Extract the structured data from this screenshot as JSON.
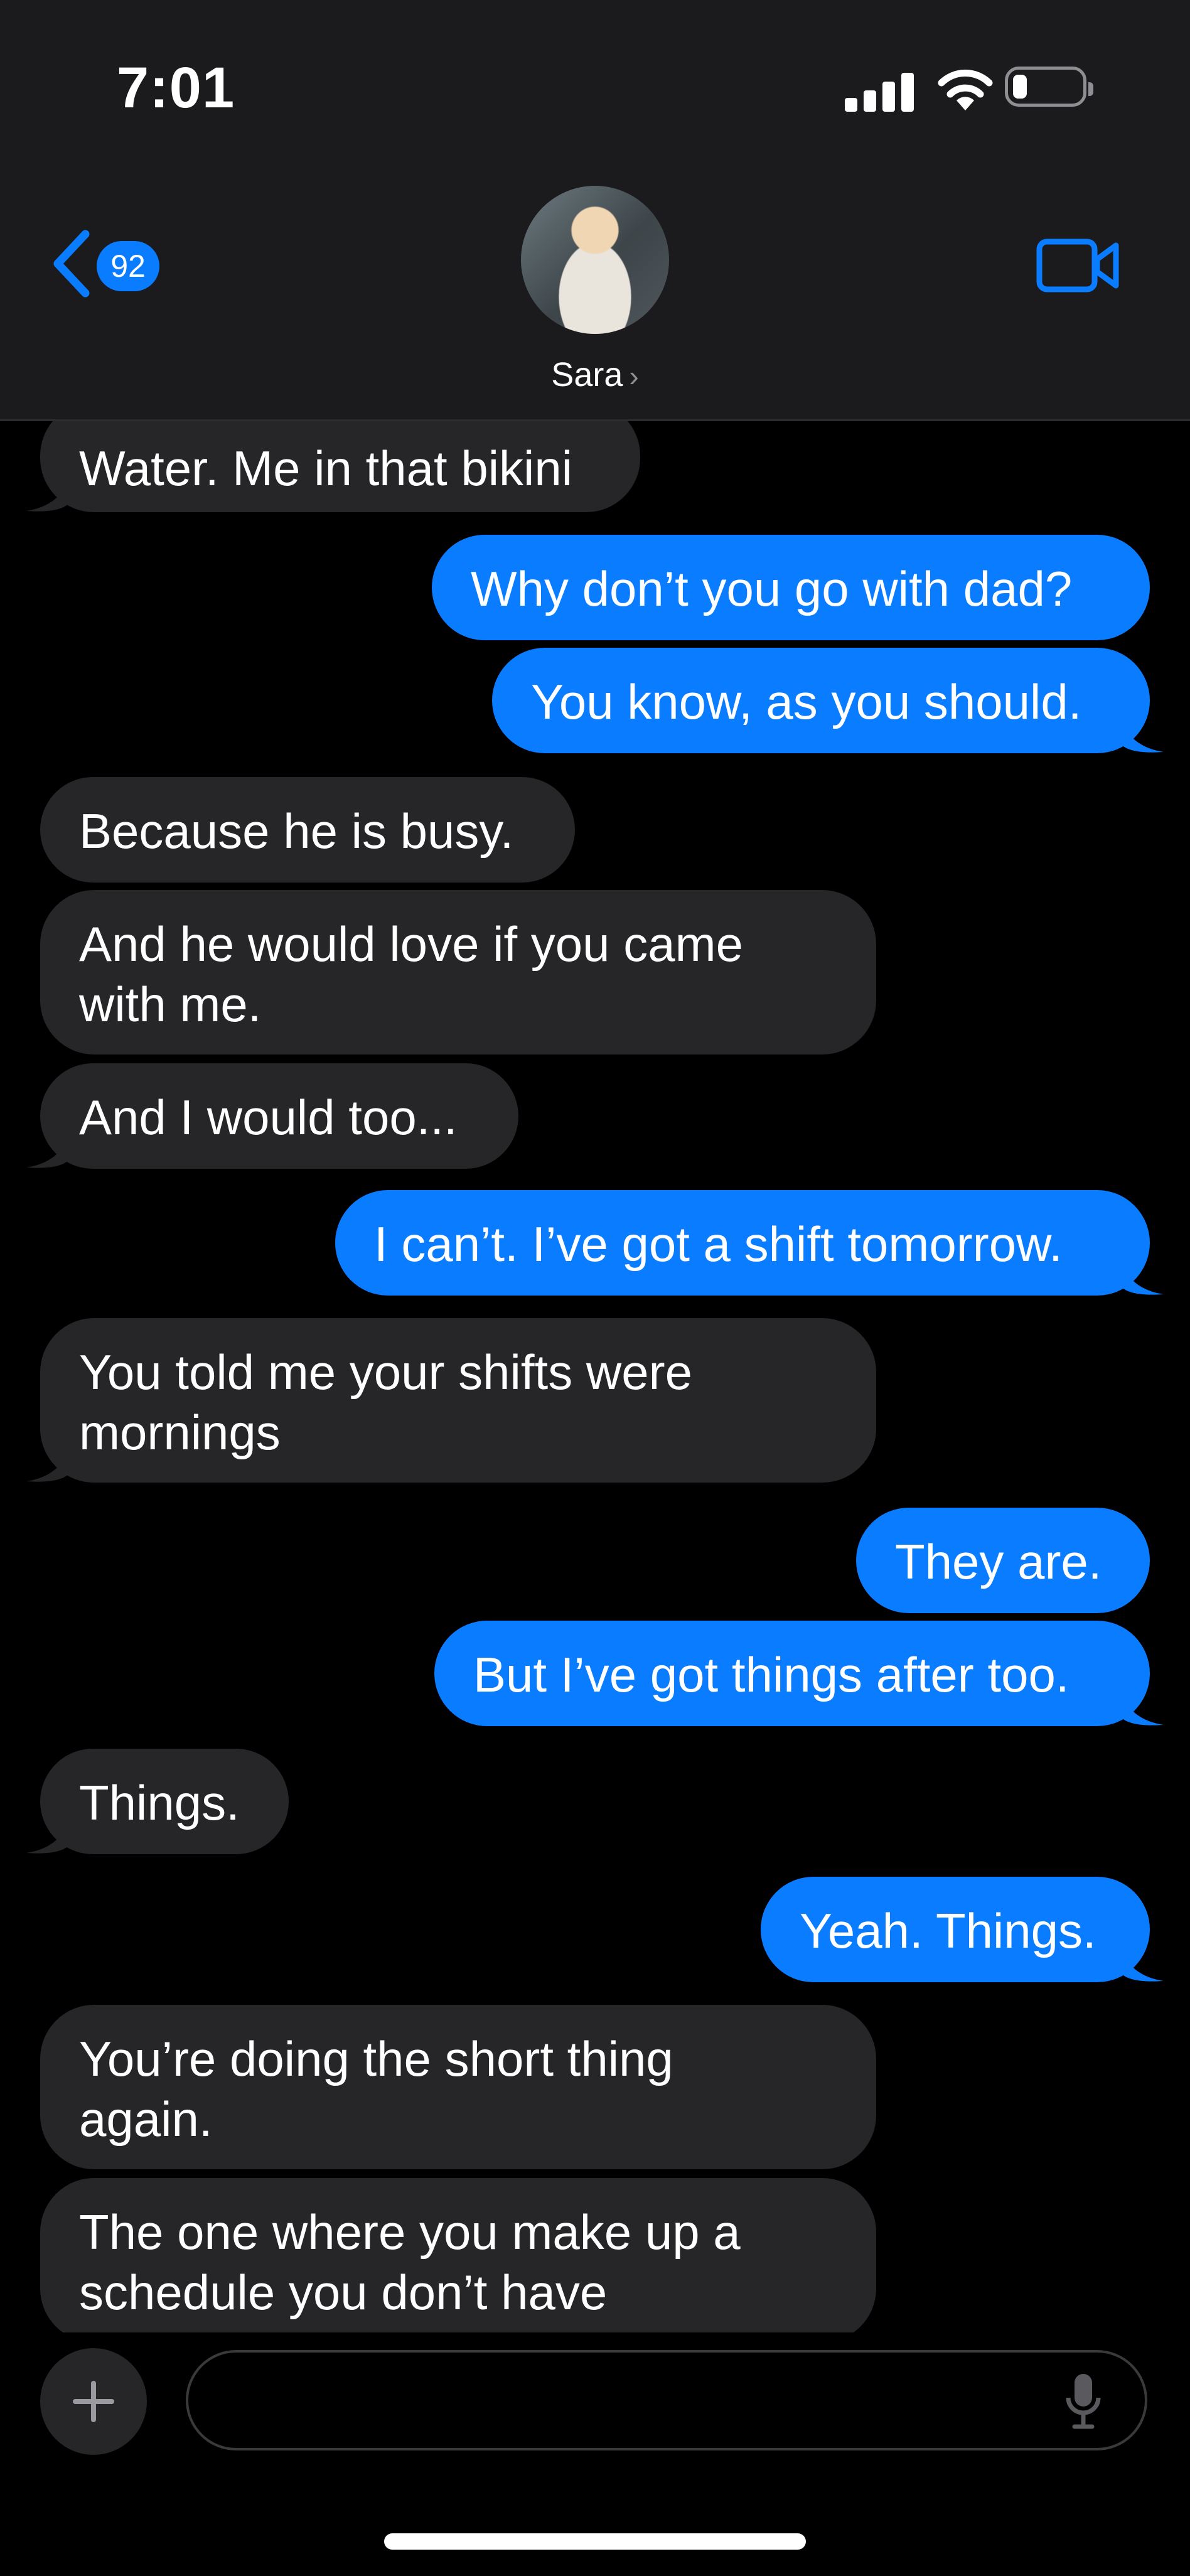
{
  "status_bar": {
    "time": "7:01"
  },
  "header": {
    "back_badge": "92",
    "contact_name": "Sara"
  },
  "messages": [
    {
      "side": "in",
      "text": "Water. Me in that bikini"
    },
    {
      "side": "out",
      "text": "Why don’t you go with dad?"
    },
    {
      "side": "out",
      "text": "You know, as you should."
    },
    {
      "side": "in",
      "text": "Because he is busy."
    },
    {
      "side": "in",
      "text": "And he would love if you came with me."
    },
    {
      "side": "in",
      "text": "And I would too..."
    },
    {
      "side": "out",
      "text": "I can’t. I’ve got a shift tomorrow."
    },
    {
      "side": "in",
      "text": "You told me your shifts were mornings"
    },
    {
      "side": "out",
      "text": "They are."
    },
    {
      "side": "out",
      "text": "But I’ve got things after too."
    },
    {
      "side": "in",
      "text": "Things."
    },
    {
      "side": "out",
      "text": "Yeah. Things."
    },
    {
      "side": "in",
      "text": "You’re doing the short thing again."
    },
    {
      "side": "in",
      "text": "The one where you make up a schedule you don’t have"
    }
  ],
  "composer": {
    "placeholder": ""
  },
  "colors": {
    "outgoing": "#0a7cff",
    "incoming": "#262628",
    "header": "#1b1b1d"
  },
  "icons": {
    "back": "chevron-left-icon",
    "video": "video-camera-icon",
    "plus": "plus-icon",
    "mic": "microphone-icon"
  }
}
